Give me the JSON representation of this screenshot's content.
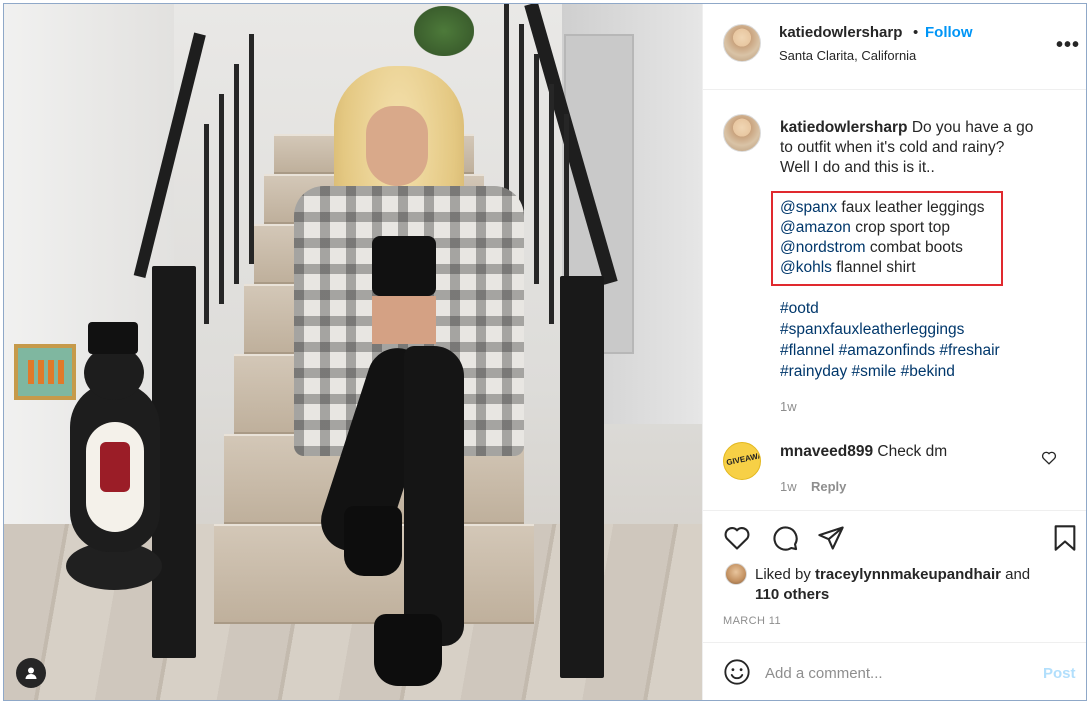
{
  "post": {
    "username": "katiedowlersharp",
    "separator": "•",
    "follow_label": "Follow",
    "location": "Santa Clarita, California",
    "more_label": "•••"
  },
  "caption": {
    "username": "katiedowlersharp",
    "line1": "Do you have a go",
    "line2": "to outfit when it's cold and rainy?",
    "line3": "Well I do and this is it..",
    "products": [
      {
        "mention": "@spanx",
        "text": "faux leather leggings"
      },
      {
        "mention": "@amazon",
        "text": "crop sport top"
      },
      {
        "mention": "@nordstrom",
        "text": "combat boots"
      },
      {
        "mention": "@kohls",
        "text": "flannel shirt"
      }
    ],
    "hashtags": {
      "line1": "#ootd",
      "line2": "#spanxfauxleatherleggings",
      "line3": "#flannel #amazonfinds #freshair",
      "line4": "#rainyday #smile #bekind"
    },
    "age": "1w"
  },
  "comment": {
    "avatar_text": "GIVEAWAY",
    "username": "mnaveed899",
    "text": "Check dm",
    "age": "1w",
    "reply_label": "Reply"
  },
  "engagement": {
    "liked_by_prefix": "Liked by",
    "liked_by_user": "traceylynnmakeupandhair",
    "and_word": "and",
    "others": "110 others",
    "date": "MARCH 11"
  },
  "add_comment": {
    "placeholder": "Add a comment...",
    "post_label": "Post"
  },
  "colors": {
    "link_blue": "#00376b",
    "follow_blue": "#0095f6",
    "highlight_red": "#e0292e",
    "muted_gray": "#8e8e8e"
  },
  "icons": [
    "heart-icon",
    "comment-icon",
    "share-icon",
    "bookmark-icon",
    "emoji-icon",
    "user-tag-icon",
    "more-options-icon"
  ]
}
